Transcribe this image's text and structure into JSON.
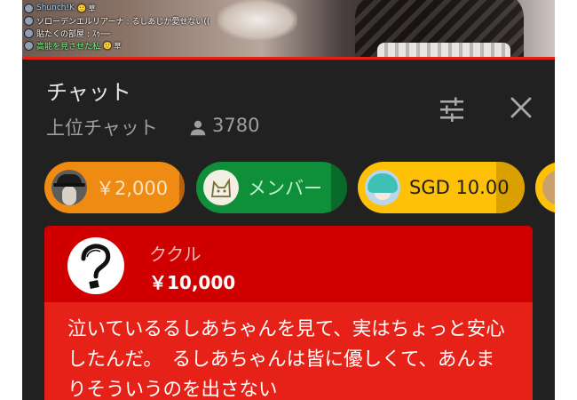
{
  "video": {
    "progress_percent": 100,
    "mini_chat": [
      {
        "name": "Shunch!K",
        "message": "🙂 草",
        "name_color": "blue"
      },
      {
        "name": "ソローデンエルリアーナ",
        "message": ": るしあじか愛せない((",
        "name_color": "none"
      },
      {
        "name": "貼たくの部屋",
        "message": ": ｽｩ──",
        "name_color": "none"
      },
      {
        "name": "高能を見させた私",
        "message": "🙂 草",
        "name_color": "green"
      }
    ]
  },
  "header": {
    "title": "チャット",
    "mode": "上位チャット",
    "viewer_count": "3780",
    "settings_icon": "tune-sliders-icon",
    "close_icon": "close-icon"
  },
  "ticker": [
    {
      "label": "￥2,000",
      "color": "#ef8b12",
      "avatar": "detective-avatar"
    },
    {
      "label": "メンバー",
      "color": "#0f8f3a",
      "avatar": "cat-drawing-avatar"
    },
    {
      "label": "SGD 10.00",
      "color": "#ffc107",
      "avatar": "anime-avatar"
    },
    {
      "label": "",
      "color": "#ffc107",
      "avatar": "partial-avatar"
    }
  ],
  "super_chat": {
    "author": "ククル",
    "amount": "￥10,000",
    "message": "泣いているるしあちゃんを見て、実はちょっと安心したんだ。　るしあちゃんは皆に優しくて、あんまりそういうのを出さない",
    "header_color": "#d00000",
    "body_color": "#e62117"
  }
}
